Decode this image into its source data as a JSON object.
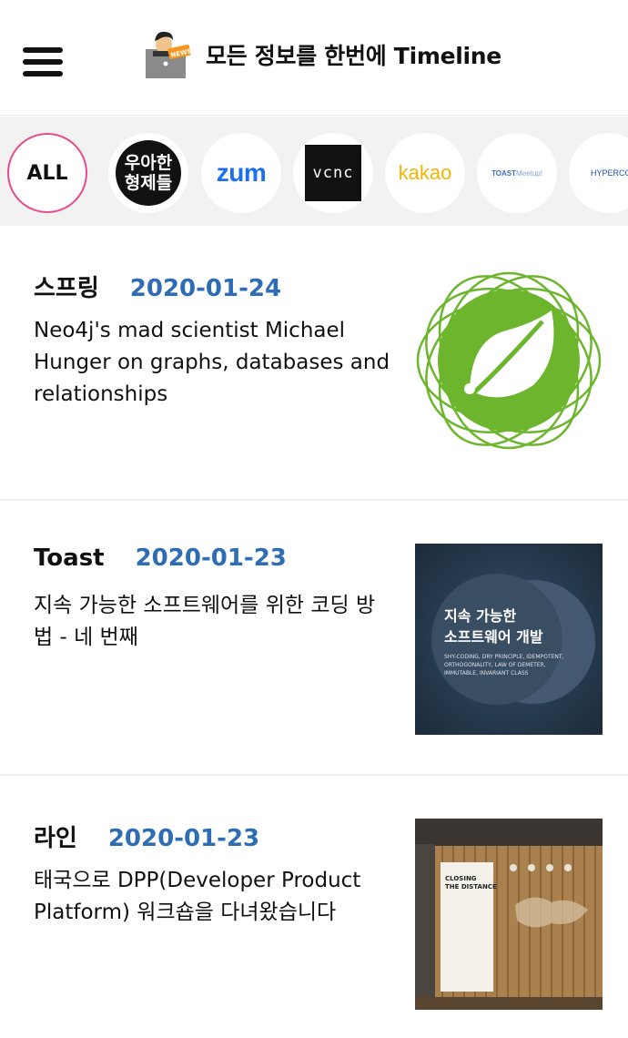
{
  "header": {
    "title": "모든 정보를 한번에 Timeline",
    "logo_badge": "NEWS"
  },
  "filters": [
    {
      "label": "ALL",
      "selected": true
    },
    {
      "label": "우아한 형제들",
      "lines": [
        "우아한",
        "형제들"
      ]
    },
    {
      "label": "zum"
    },
    {
      "label": "vcnc"
    },
    {
      "label": "kakao"
    },
    {
      "label": "TOAST Meetup!",
      "main": "TOAST",
      "sub": "Meetup!"
    },
    {
      "label": "HYPERCONNECT",
      "visible_text": "HYPERCONNE"
    }
  ],
  "posts": [
    {
      "source": "스프링",
      "date": "2020-01-24",
      "title": "Neo4j's mad scientist Michael Hunger on graphs, databases and relationships",
      "thumb": "spring-logo"
    },
    {
      "source": "Toast",
      "date": "2020-01-23",
      "title": "지속 가능한 소프트웨어를 위한 코딩 방법 - 네 번째",
      "thumb": "sustainable-software-slide",
      "thumb_text": {
        "line1": "지속 가능한",
        "line2": "소프트웨어 개발",
        "sub1": "SHY-CODING, DRY PRINCIPLE, IDEMPOTENT,",
        "sub2": "ORTHOGONALITY, LAW OF DEMETER,",
        "sub3": "IMMUTABLE, INVARIANT CLASS"
      }
    },
    {
      "source": "라인",
      "date": "2020-01-23",
      "title": "태국으로 DPP(Developer Product Platform) 워크숍을 다녀왔습니다",
      "thumb": "office-wall-photo",
      "thumb_text": {
        "line1": "CLOSING",
        "line2": "THE DISTANCE"
      }
    }
  ],
  "colors": {
    "accent_pink": "#e64b8d",
    "date_blue": "#2e6db4",
    "spring_green": "#6cb52d",
    "filter_bg": "#f2f2f2"
  }
}
